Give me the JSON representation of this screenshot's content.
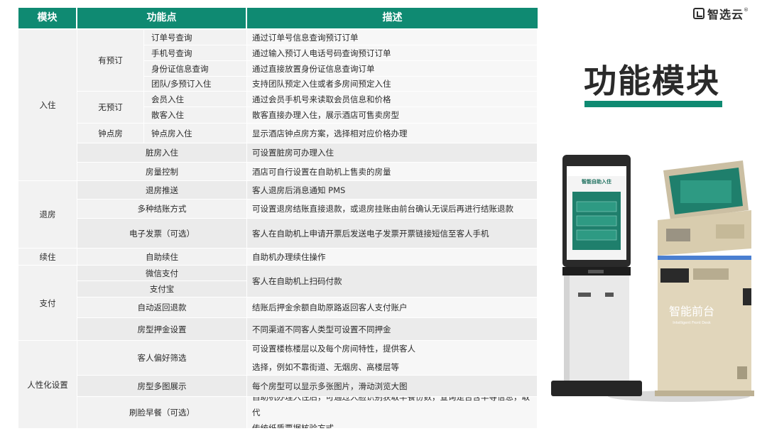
{
  "header": {
    "module": "模块",
    "function": "功能点",
    "description": "描述"
  },
  "modules": {
    "checkin": "入住",
    "checkout": "退房",
    "renew": "续住",
    "payment": "支付",
    "personal": "人性化设置"
  },
  "subgroups": {
    "reserved": "有预订",
    "unreserved": "无预订",
    "hourly": "钟点房"
  },
  "rows": [
    {
      "fn": "订单号查询",
      "desc": "通过订单号信息查询预订订单"
    },
    {
      "fn": "手机号查询",
      "desc": "通过输入预订人电话号码查询预订订单"
    },
    {
      "fn": "身份证信息查询",
      "desc": "通过直接放置身份证信息查询订单"
    },
    {
      "fn": "团队/多预订入住",
      "desc": "支持团队预定入住或者多房间预定入住"
    },
    {
      "fn": "会员入住",
      "desc": "通过会员手机号来读取会员信息和价格"
    },
    {
      "fn": "散客入住",
      "desc": "散客直接办理入住，展示酒店可售卖房型"
    },
    {
      "fn": "钟点房入住",
      "desc": "显示酒店钟点房方案，选择相对应价格办理"
    },
    {
      "fn": "脏房入住",
      "desc": "可设置脏房可办理入住"
    },
    {
      "fn": "房量控制",
      "desc": "酒店可自行设置在自助机上售卖的房量"
    },
    {
      "fn": "退房推送",
      "desc": "客人退房后消息通知 PMS"
    },
    {
      "fn": "多种结账方式",
      "desc": "可设置退房结账直接退款，或退房挂账由前台确认无误后再进行结账退款"
    },
    {
      "fn": "电子发票（可选）",
      "desc": "客人在自助机上申请开票后发送电子发票开票链接短信至客人手机"
    },
    {
      "fn": "自助续住",
      "desc": "自助机办理续住操作"
    },
    {
      "fn": "微信支付",
      "desc": "客人在自助机上扫码付款"
    },
    {
      "fn": "支付宝",
      "desc": ""
    },
    {
      "fn": "自动返回退款",
      "desc": "结账后押金余额自助原路返回客人支付账户"
    },
    {
      "fn": "房型押金设置",
      "desc": "不同渠道不同客人类型可设置不同押金"
    },
    {
      "fn": "客人偏好筛选",
      "desc": "可设置楼栋楼层以及每个房间特性，提供客人",
      "desc2": "选择，例如不靠街道、无烟房、高楼层等"
    },
    {
      "fn": "房型多图展示",
      "desc": "每个房型可以显示多张图片，滑动浏览大图"
    },
    {
      "fn": "刷脸早餐（可选）",
      "desc": "自助机办理入住后，可通过人脸识别获取早餐份数，查询是否含早等信息，取代",
      "desc2": "传统纸质票据核验方式"
    }
  ],
  "brand": {
    "logo_text": "智选云",
    "reg": "®"
  },
  "page_title": "功能模块",
  "kiosk": {
    "screen_title": "智能自助入住",
    "machine_label": "智能前台",
    "machine_sub": "Intelligent Front Desk"
  },
  "colors": {
    "accent": "#0f8a72",
    "cell": "#f2f2f2"
  }
}
